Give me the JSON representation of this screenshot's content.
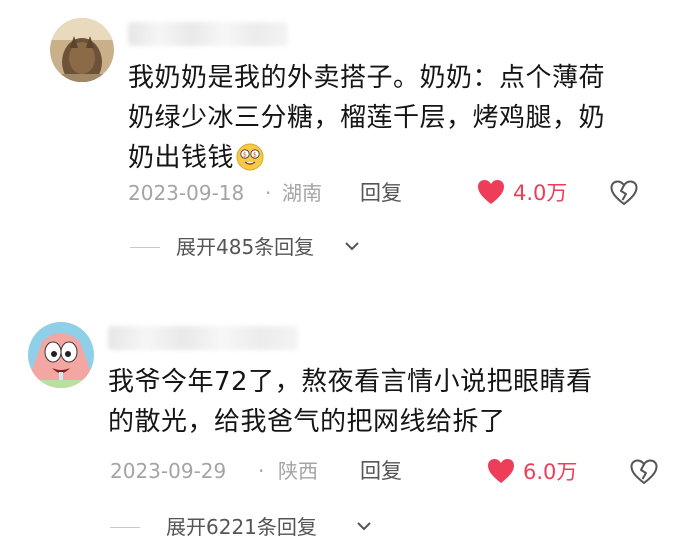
{
  "comments": [
    {
      "text_lines": [
        "我奶奶是我的外卖搭子。奶奶：点个薄荷",
        "奶绿少冰三分糖，榴莲千层，烤鸡腿，奶",
        "奶出钱钱"
      ],
      "emoji_icon": "money-eyes-emoji",
      "date": "2023-09-18",
      "separator": "·",
      "location": "湖南",
      "reply_label": "回复",
      "likes": "4.0万",
      "expand_label": "展开485条回复"
    },
    {
      "text_lines": [
        "我爷今年72了，熬夜看言情小说把眼睛看",
        "的散光，给我爸气的把网线给拆了"
      ],
      "date": "2023-09-29",
      "separator": "·",
      "location": "陕西",
      "reply_label": "回复",
      "likes": "6.0万",
      "expand_label": "展开6221条回复"
    }
  ],
  "colors": {
    "like_red": "#ee3d58",
    "meta_gray": "#a4a4a4"
  }
}
